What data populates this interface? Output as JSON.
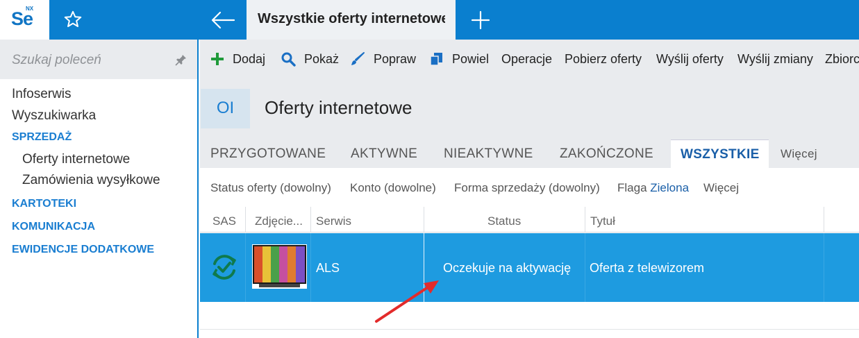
{
  "topbar": {
    "logo_text": "Se",
    "logo_sup": "NX",
    "active_tab": "Wszystkie oferty internetowe",
    "brand_color": "#0a7fcf"
  },
  "sidebar": {
    "search_placeholder": "Szukaj poleceń",
    "items": [
      {
        "label": "Infoserwis"
      },
      {
        "label": "Wyszukiwarka"
      },
      {
        "label": "SPRZEDAŻ"
      },
      {
        "label": "Oferty internetowe"
      },
      {
        "label": "Zamówienia wysyłkowe"
      },
      {
        "label": "KARTOTEKI"
      },
      {
        "label": "KOMUNIKACJA"
      },
      {
        "label": "EWIDENCJE DODATKOWE"
      }
    ]
  },
  "toolbar": {
    "add": "Dodaj",
    "show": "Pokaż",
    "edit": "Popraw",
    "duplicate": "Powiel",
    "operations": "Operacje",
    "fetch": "Pobierz oferty",
    "send_offers": "Wyślij oferty",
    "send_changes": "Wyślij zmiany",
    "collective": "Zbiorcze"
  },
  "header": {
    "badge": "OI",
    "title": "Oferty internetowe"
  },
  "tabs": [
    "PRZYGOTOWANE",
    "AKTYWNE",
    "NIEAKTYWNE",
    "ZAKOŃCZONE",
    "WSZYSTKIE",
    "Więcej"
  ],
  "filters": {
    "status": "Status oferty (dowolny)",
    "account": "Konto (dowolne)",
    "sale_form": "Forma sprzedaży (dowolny)",
    "flag_label": "Flaga",
    "flag_value": "Zielona",
    "more": "Więcej"
  },
  "table": {
    "columns": [
      "SAS",
      "Zdjęcie...",
      "Serwis",
      "Status",
      "Tytuł"
    ],
    "rows": [
      {
        "serwis": "ALS",
        "status": "Oczekuje na aktywację",
        "tytul": "Oferta z telewizorem",
        "image_icon": "tv-thumbnail",
        "sas_icon": "sync-check-icon"
      }
    ],
    "selected_color": "#1e9be0"
  }
}
